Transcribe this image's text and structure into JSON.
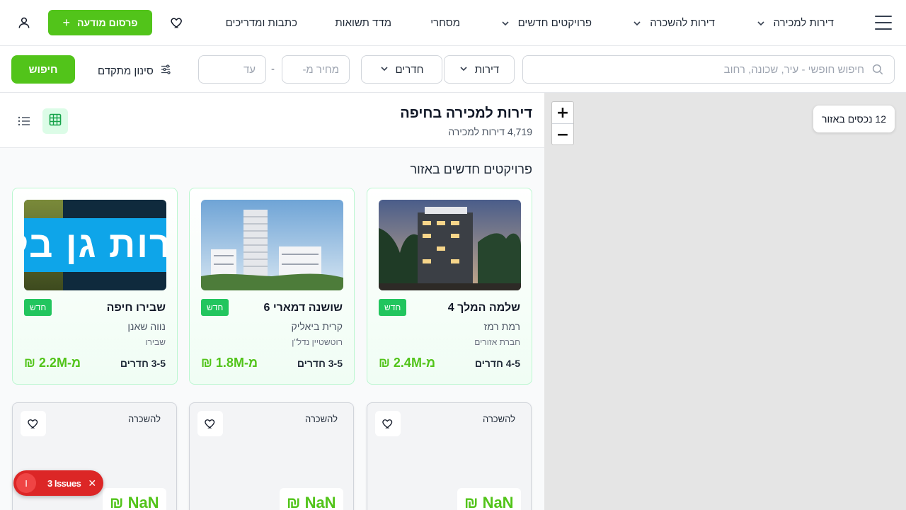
{
  "nav": {
    "menu_icon": "hamburger-icon",
    "items": [
      {
        "label": "דירות למכירה",
        "has_dropdown": true
      },
      {
        "label": "דירות להשכרה",
        "has_dropdown": true
      },
      {
        "label": "פרויקטים חדשים",
        "has_dropdown": true
      },
      {
        "label": "מסחרי",
        "has_dropdown": false
      },
      {
        "label": "מדד תשואות",
        "has_dropdown": false
      },
      {
        "label": "כתבות ומדריכים",
        "has_dropdown": false
      }
    ],
    "favorites_icon": "heart-icon",
    "publish_label": "פרסום מודעה",
    "publish_icon": "plus-icon",
    "user_icon": "user-icon"
  },
  "search": {
    "placeholder": "חיפוש חופשי - עיר, שכונה, רחוב",
    "type_label": "דירות",
    "rooms_label": "חדרים",
    "price_from_placeholder": "מחיר מ-",
    "price_separator": "-",
    "price_to_placeholder": "עד",
    "advanced_label": "סינון מתקדם",
    "button_label": "חיפוש"
  },
  "listing": {
    "title": "דירות למכירה בחיפה",
    "subtitle": "4,719 דירות למכירה",
    "section_title": "פרויקטים חדשים באזור"
  },
  "projects": [
    {
      "name": "שלמה המלך 4",
      "badge": "חדש",
      "area": "רמת רמז",
      "developer": "חברת אזורים",
      "rooms": "4-5 חדרים",
      "price": "מ-2.4M ₪"
    },
    {
      "name": "שושנה דמארי 6",
      "badge": "חדש",
      "area": "קרית ביאליק",
      "developer": "רוטשטיין נדל\"ן",
      "rooms": "3-5 חדרים",
      "price": "מ-1.8M ₪"
    },
    {
      "name": "שבירו חיפה",
      "badge": "חדש",
      "area": "נווה שאנן",
      "developer": "שבירו",
      "rooms": "3-5 חדרים",
      "price": "מ-2.2M ₪",
      "image_text": "דירות גן בלב"
    }
  ],
  "rentals": [
    {
      "label": "להשכרה",
      "price": "NaN ₪"
    },
    {
      "label": "להשכרה",
      "price": "NaN ₪"
    },
    {
      "label": "להשכרה",
      "price": "NaN ₪"
    }
  ],
  "map": {
    "zoom_in": "+",
    "zoom_out": "−",
    "count_label": "12 נכסים באזור"
  },
  "issues": {
    "indicator": "I",
    "label": "3 Issues",
    "close": "✕"
  },
  "colors": {
    "brand_green": "#52c41a",
    "badge_green": "#22c55e",
    "issues_red": "#dc2626"
  }
}
